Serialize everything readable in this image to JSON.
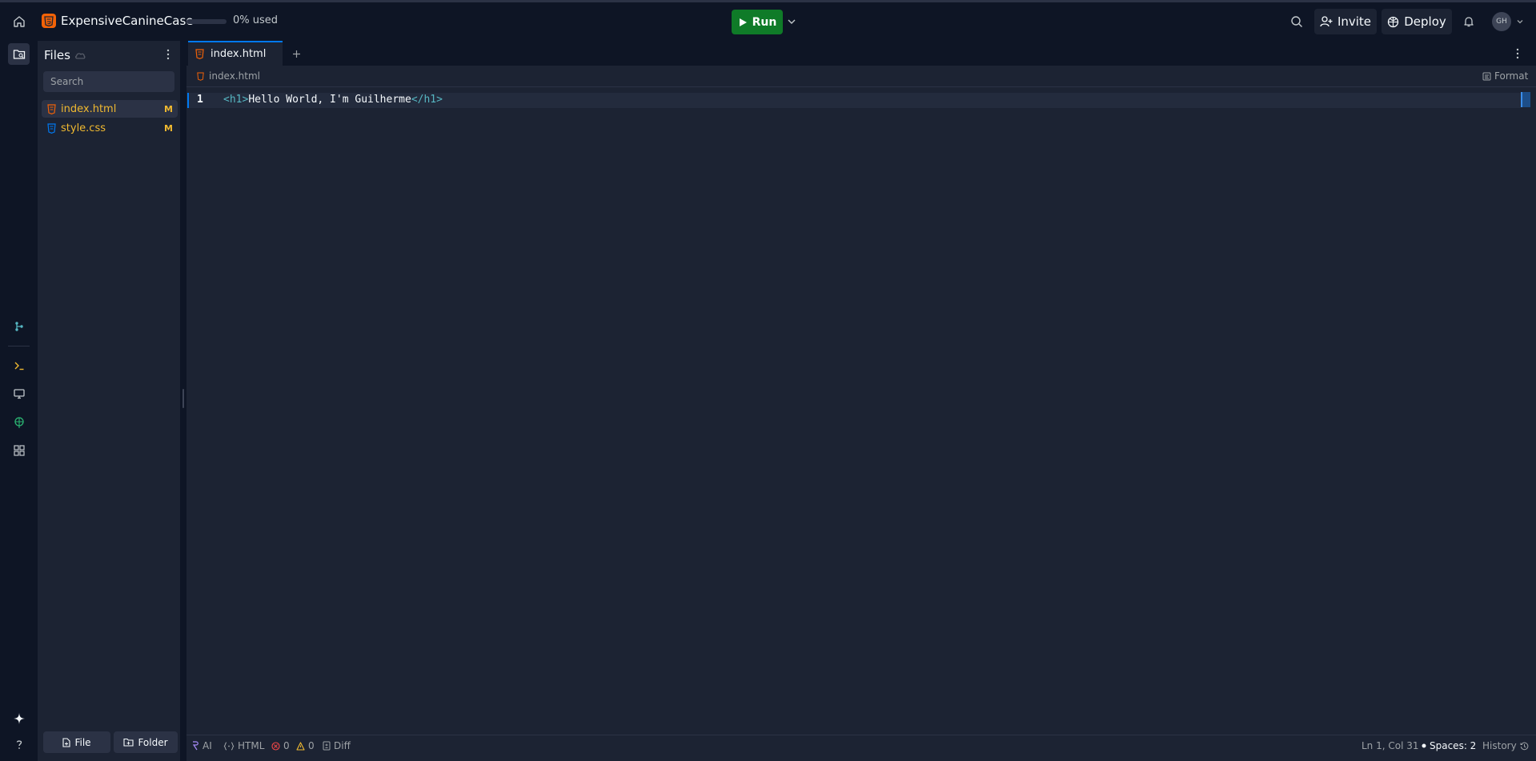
{
  "topbar": {
    "app_name": "ExpensiveCanineCase",
    "usage_percent": 0,
    "usage_text": "0% used",
    "run_label": "Run",
    "invite_label": "Invite",
    "deploy_label": "Deploy",
    "avatar_initials": "GH"
  },
  "filepanel": {
    "title": "Files",
    "search_placeholder": "Search",
    "files": [
      {
        "name": "index.html",
        "flag": "M",
        "type": "html",
        "active": true
      },
      {
        "name": "style.css",
        "flag": "M",
        "type": "css",
        "active": false
      }
    ],
    "new_file_label": "File",
    "new_folder_label": "Folder"
  },
  "editor": {
    "tab_label": "index.html",
    "breadcrumb": "index.html",
    "format_label": "Format",
    "line_number": "1",
    "code": {
      "open_tag_lt": "<",
      "open_tag_name": "h1",
      "open_tag_gt": ">",
      "text": "Hello World, I'm Guilherme",
      "close_tag_lt": "</",
      "close_tag_name": "h1",
      "close_tag_gt": ">"
    }
  },
  "statusbar": {
    "ai_label": "AI",
    "language_label": "HTML",
    "errors": "0",
    "warnings": "0",
    "diff_label": "Diff",
    "cursor_position": "Ln 1, Col 31",
    "spaces_label": "Spaces: 2",
    "history_label": "History"
  },
  "colors": {
    "run_green": "#0f7b28",
    "accent_blue": "#0079f2",
    "html_orange": "#f26207",
    "css_blue": "#0079f2",
    "modified_yellow": "#f0b930"
  }
}
